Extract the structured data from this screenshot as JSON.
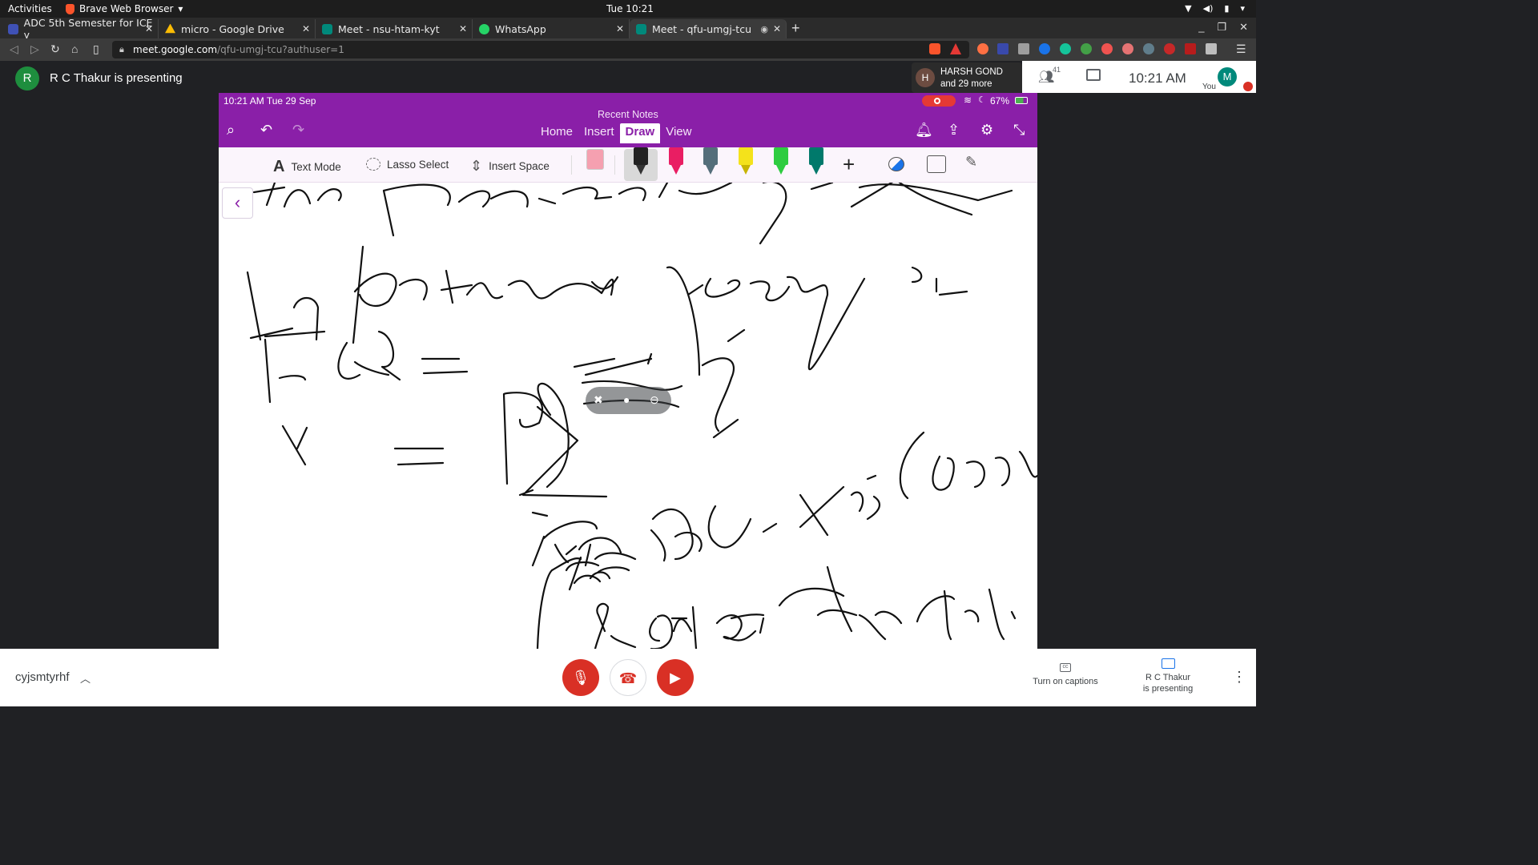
{
  "desktop": {
    "activities": "Activities",
    "app_name": "Brave Web Browser",
    "clock": "Tue 10:21"
  },
  "tabs": [
    {
      "title": "ADC 5th Semester for ICE y",
      "favicon_color": "#4285f4"
    },
    {
      "title": "micro - Google Drive",
      "favicon_color": "#fbbc04"
    },
    {
      "title": "Meet - nsu-htam-kyt",
      "favicon_color": "#00897b"
    },
    {
      "title": "WhatsApp",
      "favicon_color": "#25d366"
    },
    {
      "title": "Meet - qfu-umgj-tcu",
      "favicon_color": "#00897b"
    }
  ],
  "address": {
    "host": "meet.google.com",
    "path": "/qfu-umgj-tcu?authuser=1"
  },
  "meet": {
    "presenter_initial": "R",
    "presenting_text": "R C Thakur is presenting",
    "chip_initial": "H",
    "chip_name": "HARSH GOND",
    "chip_more": "and 29 more",
    "participants_count": "41",
    "time": "10:21 AM",
    "you_initial": "M",
    "you_label": "You",
    "meeting_code": "cyjsmtyrhf",
    "captions_label": "Turn on captions",
    "presenting_line1": "R C Thakur",
    "presenting_line2": "is presenting"
  },
  "ipad": {
    "status_time": "10:21 AM   Tue 29 Sep",
    "battery": "67%",
    "recent_notes": "Recent Notes",
    "ribbon_tabs": [
      "Home",
      "Insert",
      "Draw",
      "View"
    ],
    "active_tab": "Draw",
    "tools": {
      "text_mode": "Text Mode",
      "lasso_select": "Lasso Select",
      "insert_space": "Insert Space"
    },
    "pen_colors": [
      "#222222",
      "#e91e63",
      "#546e7a",
      "#f4e21b",
      "#2ecc40",
      "#00796b"
    ]
  },
  "colors": {
    "onenote_purple": "#8a1fa8",
    "meet_red": "#d93025",
    "meet_green": "#1e8e3e"
  }
}
